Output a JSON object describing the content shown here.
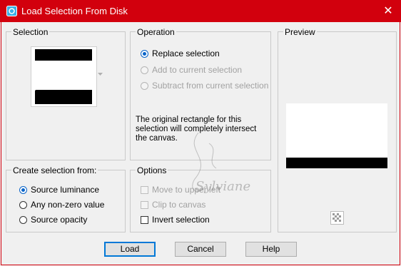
{
  "window": {
    "title": "Load Selection From Disk",
    "close_glyph": "✕"
  },
  "selection": {
    "label": "Selection"
  },
  "operation": {
    "label": "Operation",
    "options": [
      {
        "label": "Replace selection",
        "checked": true,
        "enabled": true
      },
      {
        "label": "Add to current selection",
        "checked": false,
        "enabled": false
      },
      {
        "label": "Subtract from current selection",
        "checked": false,
        "enabled": false
      }
    ],
    "note": "The original rectangle for this selection will completely intersect the canvas."
  },
  "preview": {
    "label": "Preview"
  },
  "create_from": {
    "label": "Create selection from:",
    "options": [
      {
        "label": "Source luminance",
        "checked": true
      },
      {
        "label": "Any non-zero value",
        "checked": false
      },
      {
        "label": "Source opacity",
        "checked": false
      }
    ]
  },
  "options": {
    "label": "Options",
    "items": [
      {
        "label": "Move to upper left",
        "checked": false,
        "enabled": false
      },
      {
        "label": "Clip to canvas",
        "checked": false,
        "enabled": false
      },
      {
        "label": "Invert selection",
        "checked": false,
        "enabled": true
      }
    ]
  },
  "buttons": {
    "load": "Load",
    "cancel": "Cancel",
    "help": "Help"
  },
  "watermark": {
    "text": "Sylviane"
  },
  "colors": {
    "titlebar": "#d2000d",
    "accent": "#0a64c8"
  }
}
